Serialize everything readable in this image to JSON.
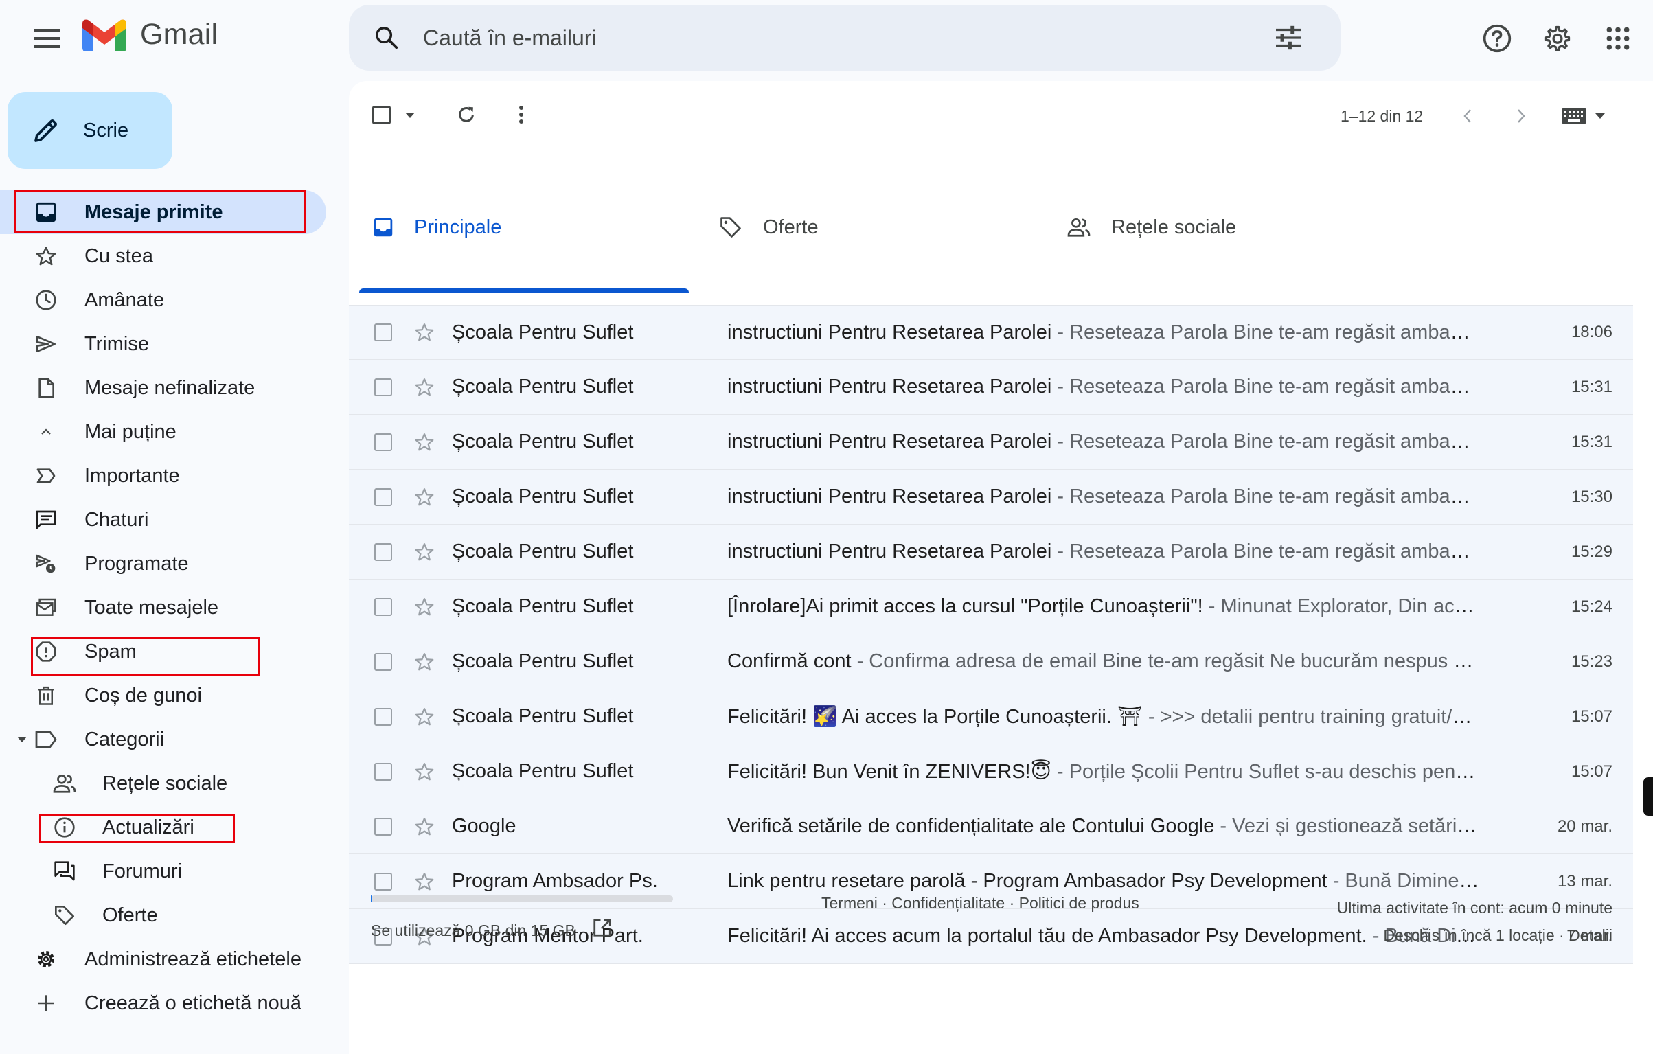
{
  "header": {
    "app_name": "Gmail",
    "search_placeholder": "Caută în e-mailuri"
  },
  "sidebar": {
    "compose_label": "Scrie",
    "items": [
      {
        "label": "Mesaje primite",
        "icon": "inbox-icon",
        "active": true
      },
      {
        "label": "Cu stea",
        "icon": "star-icon"
      },
      {
        "label": "Amânate",
        "icon": "clock-icon"
      },
      {
        "label": "Trimise",
        "icon": "send-icon"
      },
      {
        "label": "Mesaje nefinalizate",
        "icon": "draft-icon"
      },
      {
        "label": "Mai puține",
        "icon": "chevron-up-icon"
      },
      {
        "label": "Importante",
        "icon": "label-important-icon"
      },
      {
        "label": "Chaturi",
        "icon": "chat-icon"
      },
      {
        "label": "Programate",
        "icon": "scheduled-send-icon"
      },
      {
        "label": "Toate mesajele",
        "icon": "all-mail-icon"
      },
      {
        "label": "Spam",
        "icon": "report-icon"
      },
      {
        "label": "Coș de gunoi",
        "icon": "trash-icon"
      },
      {
        "label": "Categorii",
        "icon": "label-icon"
      },
      {
        "label": "Rețele sociale",
        "icon": "people-icon"
      },
      {
        "label": "Actualizări",
        "icon": "info-icon"
      },
      {
        "label": "Forumuri",
        "icon": "forum-icon"
      },
      {
        "label": "Oferte",
        "icon": "tag-icon"
      },
      {
        "label": "Administrează etichetele",
        "icon": "settings-icon"
      },
      {
        "label": "Creează o etichetă nouă",
        "icon": "plus-icon"
      }
    ]
  },
  "toolbar": {
    "pager": "1–12 din 12"
  },
  "tabs": [
    {
      "label": "Principale",
      "icon": "inbox-icon",
      "active": true
    },
    {
      "label": "Oferte",
      "icon": "tag-icon"
    },
    {
      "label": "Rețele sociale",
      "icon": "people-icon"
    }
  ],
  "emails": [
    {
      "sender": "Școala Pentru Suflet",
      "subject": "instructiuni Pentru Resetarea Parolei",
      "snippet": " - Reseteaza Parola Bine te-am regăsit ambasad...",
      "time": "18:06"
    },
    {
      "sender": "Școala Pentru Suflet",
      "subject": "instructiuni Pentru Resetarea Parolei",
      "snippet": " - Reseteaza Parola Bine te-am regăsit ambasad...",
      "time": "15:31"
    },
    {
      "sender": "Școala Pentru Suflet",
      "subject": "instructiuni Pentru Resetarea Parolei",
      "snippet": " - Reseteaza Parola Bine te-am regăsit ambasad...",
      "time": "15:31"
    },
    {
      "sender": "Școala Pentru Suflet",
      "subject": "instructiuni Pentru Resetarea Parolei",
      "snippet": " - Reseteaza Parola Bine te-am regăsit ambasad...",
      "time": "15:30"
    },
    {
      "sender": "Școala Pentru Suflet",
      "subject": "instructiuni Pentru Resetarea Parolei",
      "snippet": " - Reseteaza Parola Bine te-am regăsit ambasad...",
      "time": "15:29"
    },
    {
      "sender": "Școala Pentru Suflet",
      "subject": "[Înrolare]Ai primit acces la cursul \"Porțile Cunoașterii\"!",
      "snippet": " - Minunat Explorator, Din aces...",
      "time": "15:24"
    },
    {
      "sender": "Școala Pentru Suflet",
      "subject": "Confirmă cont",
      "snippet": " - Confirma adresa de email Bine te-am regăsit Ne bucurăm nespus pe...",
      "time": "15:23"
    },
    {
      "sender": "Școala Pentru Suflet",
      "subject": "Felicitări! 🌠 Ai acces la Porțile Cunoașterii. ⛩",
      "snippet": " - >>> detalii pentru training gratuit/Șc...",
      "time": "15:07"
    },
    {
      "sender": "Școala Pentru Suflet",
      "subject": "Felicitări! Bun Venit în ZENIVERS!😇",
      "snippet": " - Porțile Școlii Pentru Suflet s-au deschis pentru ...",
      "time": "15:07"
    },
    {
      "sender": "Google",
      "subject": "Verifică setările de confidențialitate ale Contului Google",
      "snippet": " - Vezi și gestionează setările...",
      "time": "20 mar."
    },
    {
      "sender": "Program Ambsador Ps.",
      "subject": "Link pentru resetare parolă - Program Ambasador Psy Development",
      "snippet": " - Bună Dimineaț...",
      "time": "13 mar."
    },
    {
      "sender": "Program Mentor Part.",
      "subject": "Felicitări! Ai acces acum la portalul tău de Ambasador Psy Development.",
      "snippet": " - Bună Dimi...",
      "time": "7 mar."
    }
  ],
  "footer": {
    "storage": "Se utilizează 0 GB din 15 GB",
    "storage_used_fraction": 0,
    "links": "Termeni · Confidențialitate · Politici de produs",
    "activity": "Ultima activitate în cont: acum 0 minute",
    "sessions": "Deschis în încă 1 locație · Detalii"
  },
  "colors": {
    "accent": "#0b57d0",
    "compose_bg": "#c2e7ff",
    "active_nav_bg": "#d3e3fd",
    "annotation_red": "#e8000b"
  }
}
